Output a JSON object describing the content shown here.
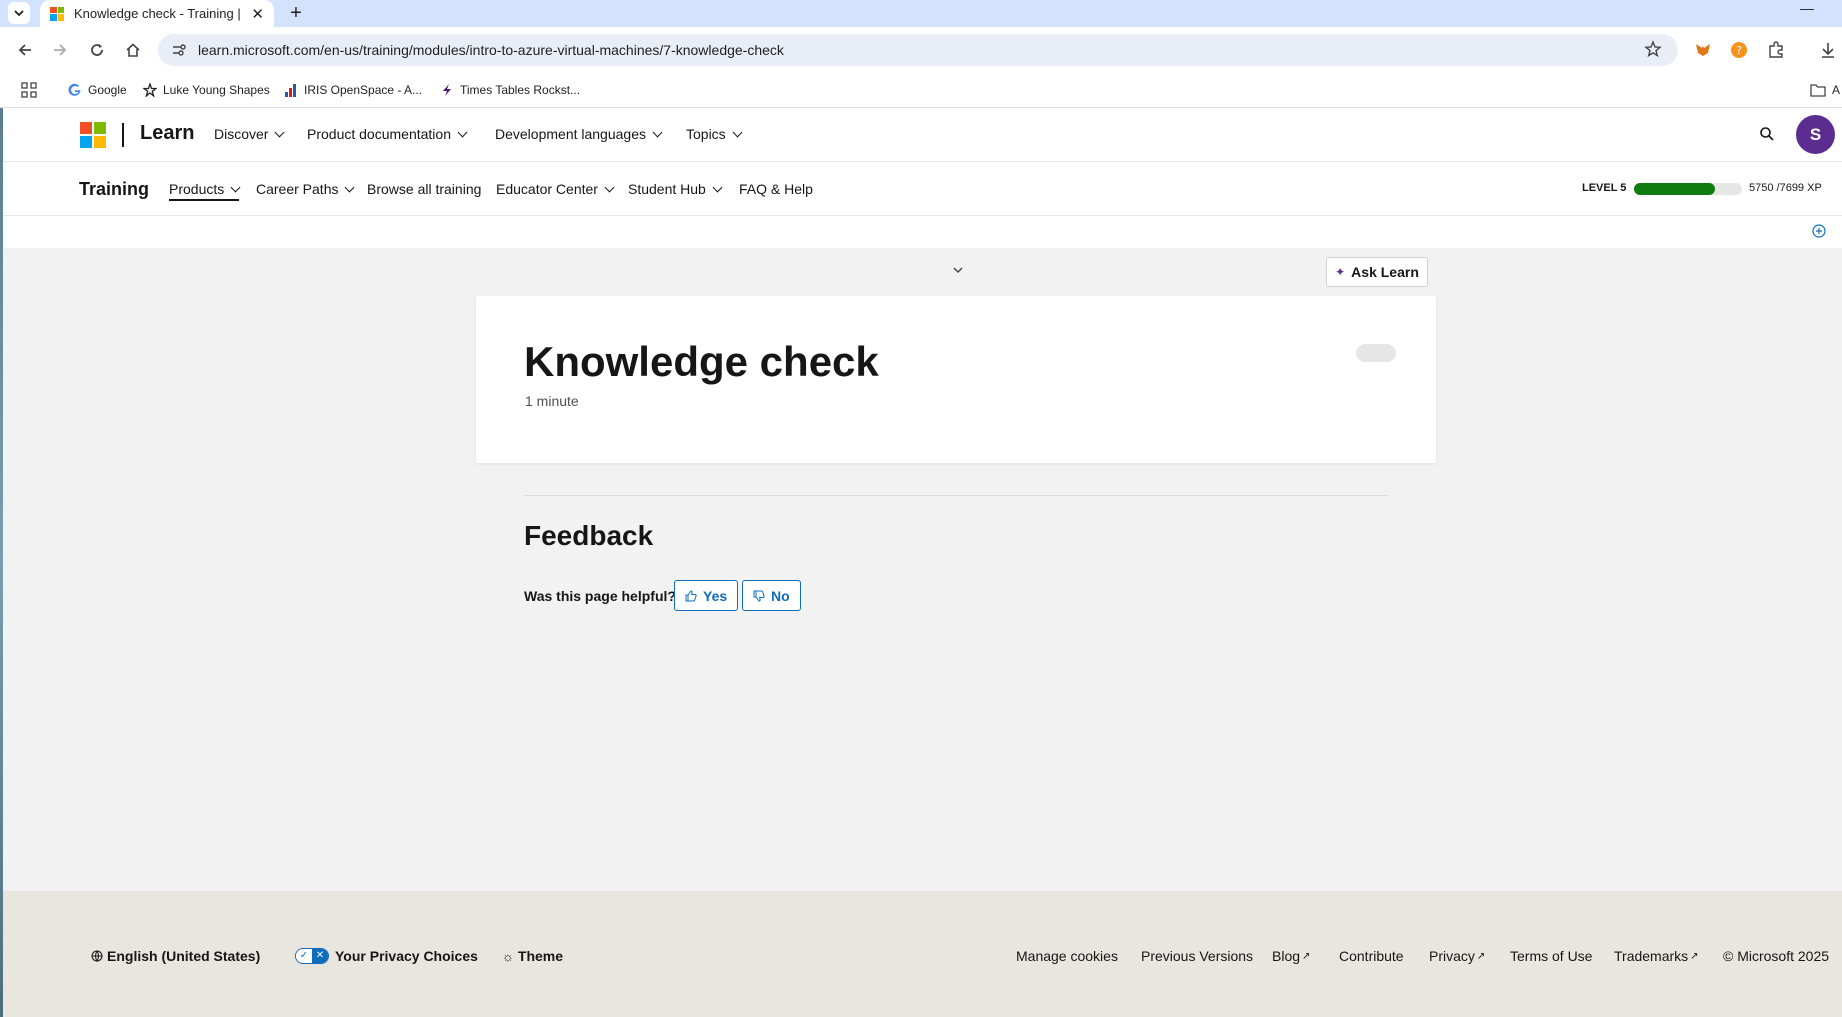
{
  "browser": {
    "tab_title": "Knowledge check - Training | M",
    "url": "learn.microsoft.com/en-us/training/modules/intro-to-azure-virtual-machines/7-knowledge-check",
    "bookmarks": [
      {
        "label": "Google"
      },
      {
        "label": "Luke Young Shapes"
      },
      {
        "label": "IRIS OpenSpace - A..."
      },
      {
        "label": "Times Tables Rockst..."
      }
    ],
    "bookmark_folder_label": "A"
  },
  "header": {
    "brand": "Learn",
    "nav": [
      {
        "label": "Discover"
      },
      {
        "label": "Product documentation"
      },
      {
        "label": "Development languages"
      },
      {
        "label": "Topics"
      }
    ],
    "avatar_initial": "S"
  },
  "subheader": {
    "title": "Training",
    "nav": [
      {
        "label": "Products"
      },
      {
        "label": "Career Paths"
      },
      {
        "label": "Browse all training"
      },
      {
        "label": "Educator Center"
      },
      {
        "label": "Student Hub"
      },
      {
        "label": "FAQ & Help"
      }
    ],
    "level_label": "LEVEL 5",
    "xp_current": 5750,
    "xp_total": 7699,
    "xp_text": "5750 /7699 XP"
  },
  "main": {
    "ask_learn_label": "Ask Learn",
    "title": "Knowledge check",
    "duration": "1 minute"
  },
  "feedback": {
    "heading": "Feedback",
    "question": "Was this page helpful?",
    "yes_label": "Yes",
    "no_label": "No"
  },
  "footer": {
    "language": "English (United States)",
    "privacy_choices": "Your Privacy Choices",
    "theme": "Theme",
    "links": [
      {
        "label": "Manage cookies"
      },
      {
        "label": "Previous Versions"
      },
      {
        "label": "Blog"
      },
      {
        "label": "Contribute"
      },
      {
        "label": "Privacy"
      },
      {
        "label": "Terms of Use"
      },
      {
        "label": "Trademarks"
      }
    ],
    "copyright": "© Microsoft 2025"
  },
  "colors": {
    "accent": "#0f6cbd",
    "xp_fill": "#107c10",
    "avatar": "#5c2d91"
  }
}
